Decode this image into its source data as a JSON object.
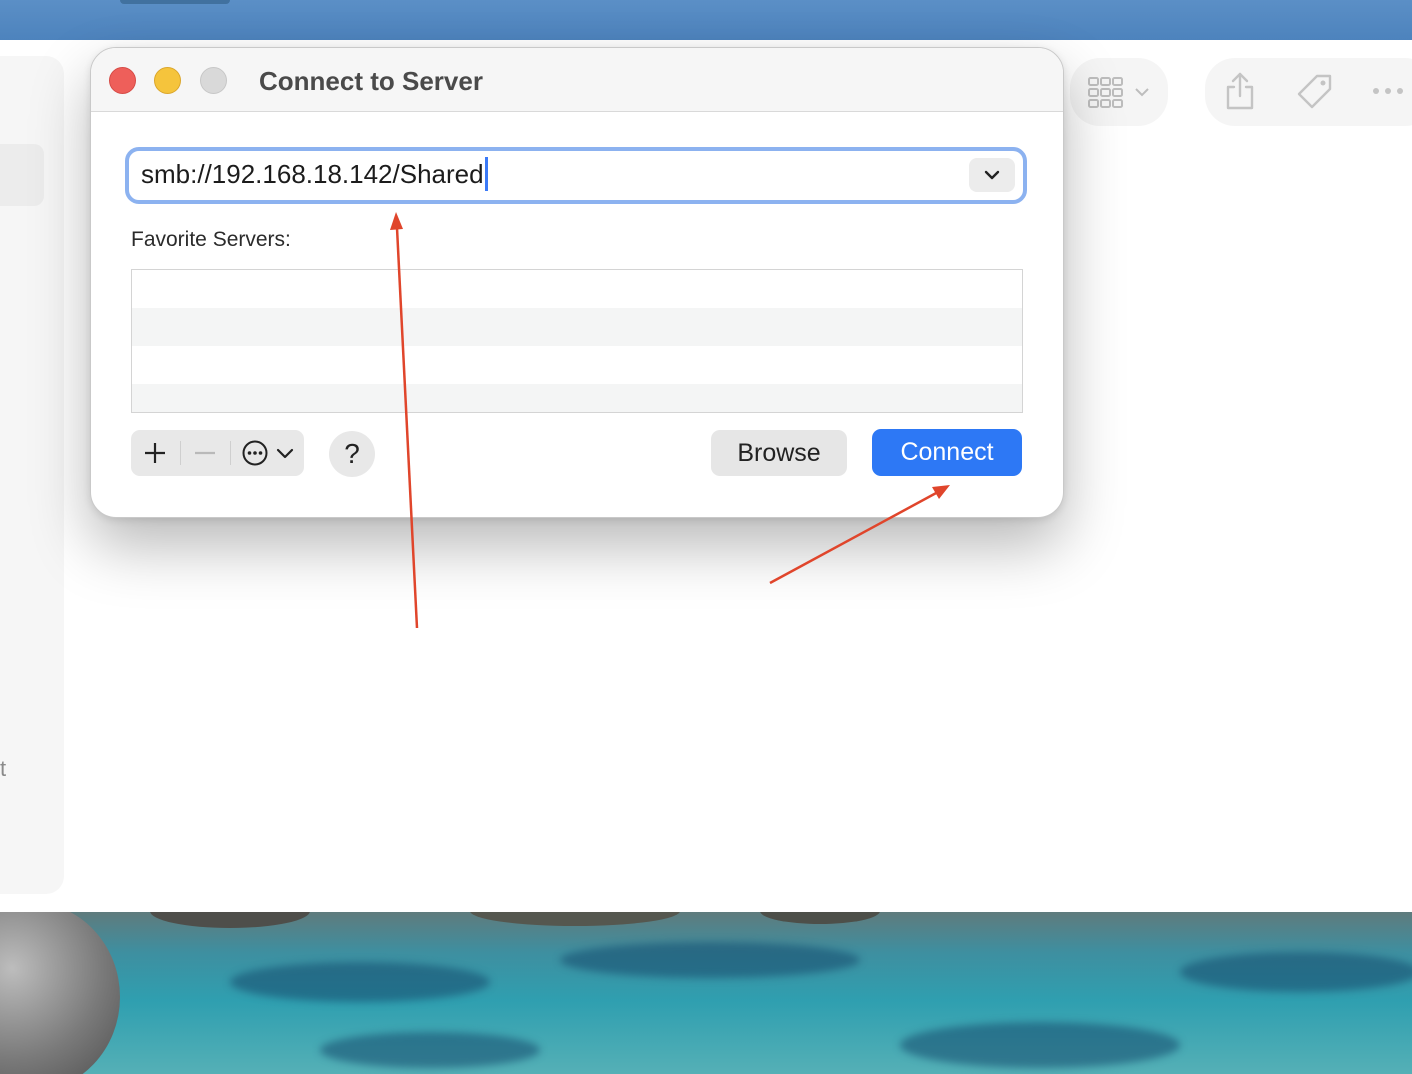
{
  "dialog": {
    "title": "Connect to Server",
    "address_value": "smb://192.168.18.142/Shared",
    "favorites_label": "Favorite Servers:",
    "favorites": [],
    "help_label": "?",
    "browse_label": "Browse",
    "connect_label": "Connect"
  },
  "finder": {
    "sidebar_partial_text": "t"
  },
  "icons": {
    "address_dropdown": "chevron-down-icon",
    "add": "plus-icon",
    "remove": "minus-icon",
    "more": "ellipsis-circle-icon",
    "view": "grid-view-icon",
    "share": "share-icon",
    "tag": "tag-icon",
    "overflow": "more-icon"
  },
  "colors": {
    "accent": "#2d78f5",
    "focus_ring": "#8cb2f0",
    "annotation_arrow": "#e0452b",
    "traffic_close": "#ee5f5a",
    "traffic_minimize": "#f5c43c",
    "traffic_zoom_inactive": "#d9d9d9"
  }
}
